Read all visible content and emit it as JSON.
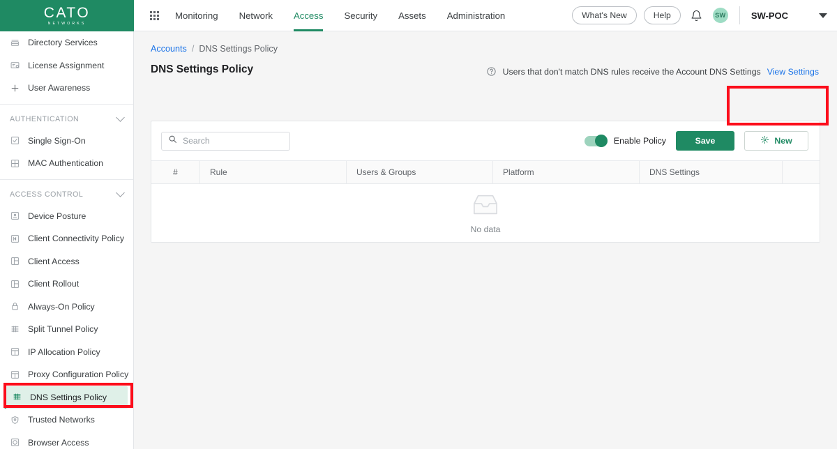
{
  "brand": {
    "logo_main": "CATO",
    "logo_sub": "NETWORKS",
    "accent_green": "#1f8a63",
    "link_blue": "#1a73e8",
    "annotation_red": "#fc0d1b"
  },
  "topbar": {
    "apps_icon": "grid-apps-icon",
    "nav_items": [
      {
        "label": "Monitoring",
        "active": false
      },
      {
        "label": "Network",
        "active": false
      },
      {
        "label": "Access",
        "active": true
      },
      {
        "label": "Security",
        "active": false
      },
      {
        "label": "Assets",
        "active": false
      },
      {
        "label": "Administration",
        "active": false
      }
    ],
    "whats_new": "What's New",
    "help": "Help",
    "notifications_icon": "bell-icon",
    "avatar_initials": "SW",
    "account_name": "SW-POC",
    "account_caret_icon": "caret-down-icon"
  },
  "sidebar": {
    "items": [
      {
        "label": "Directory Services",
        "icon": "directory-services-icon",
        "type": "item",
        "selected": false
      },
      {
        "label": "License Assignment",
        "icon": "license-assignment-icon",
        "type": "item",
        "selected": false
      },
      {
        "label": "User Awareness",
        "icon": "plus-icon",
        "type": "item",
        "selected": false
      },
      {
        "label": "AUTHENTICATION",
        "icon": "chevron-down-icon",
        "type": "group"
      },
      {
        "label": "Single Sign-On",
        "icon": "checkbox-icon",
        "type": "item",
        "selected": false
      },
      {
        "label": "MAC Authentication",
        "icon": "grid-four-icon",
        "type": "item",
        "selected": false
      },
      {
        "label": "ACCESS CONTROL",
        "icon": "chevron-down-icon",
        "type": "group"
      },
      {
        "label": "Device Posture",
        "icon": "device-posture-icon",
        "type": "item",
        "selected": false
      },
      {
        "label": "Client Connectivity Policy",
        "icon": "client-connectivity-icon",
        "type": "item",
        "selected": false
      },
      {
        "label": "Client Access",
        "icon": "panel-icon",
        "type": "item",
        "selected": false
      },
      {
        "label": "Client Rollout",
        "icon": "panel-icon",
        "type": "item",
        "selected": false
      },
      {
        "label": "Always-On Policy",
        "icon": "lock-icon",
        "type": "item",
        "selected": false
      },
      {
        "label": "Split Tunnel Policy",
        "icon": "split-tunnel-icon",
        "type": "item",
        "selected": false
      },
      {
        "label": "IP Allocation Policy",
        "icon": "ip-allocation-icon",
        "type": "item",
        "selected": false
      },
      {
        "label": "Proxy Configuration Policy",
        "icon": "proxy-config-icon",
        "type": "item",
        "selected": false
      },
      {
        "label": "DNS Settings Policy",
        "icon": "dns-settings-icon",
        "type": "item",
        "selected": true
      },
      {
        "label": "Trusted Networks",
        "icon": "shield-icon",
        "type": "item",
        "selected": false
      },
      {
        "label": "Browser Access",
        "icon": "browser-access-icon",
        "type": "item",
        "selected": false
      }
    ]
  },
  "main": {
    "breadcrumb": {
      "root": "Accounts",
      "separator": "/",
      "current": "DNS Settings Policy"
    },
    "page_title": "DNS Settings Policy",
    "hint": {
      "icon": "question-circle-icon",
      "text": "Users that don't match DNS rules receive the Account DNS Settings",
      "link": "View Settings"
    },
    "toolbar": {
      "search_placeholder": "Search",
      "search_value": "",
      "search_icon": "search-icon",
      "toggle_label": "Enable Policy",
      "toggle_on": true,
      "save_label": "Save",
      "new_label": "New",
      "new_icon": "sparkle-plus-icon"
    },
    "table": {
      "columns": [
        "#",
        "Rule",
        "Users & Groups",
        "Platform",
        "DNS Settings",
        ""
      ],
      "rows": [],
      "empty_icon": "empty-inbox-icon",
      "empty_label": "No data"
    }
  }
}
